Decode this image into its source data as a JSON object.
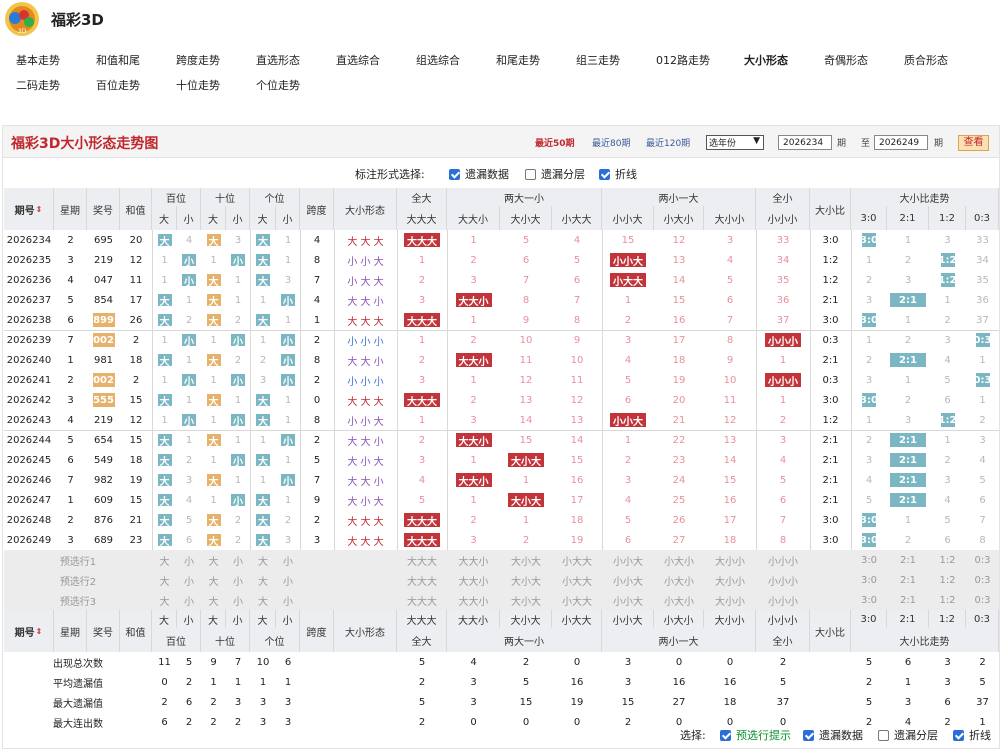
{
  "app": {
    "title": "福彩3D",
    "logo_icon": "lottery-ball-logo-icon"
  },
  "nav": [
    {
      "label": "基本走势",
      "active": false
    },
    {
      "label": "和值和尾",
      "active": false
    },
    {
      "label": "跨度走势",
      "active": false
    },
    {
      "label": "直选形态",
      "active": false
    },
    {
      "label": "直选综合",
      "active": false
    },
    {
      "label": "组选综合",
      "active": false
    },
    {
      "label": "和尾走势",
      "active": false
    },
    {
      "label": "组三走势",
      "active": false
    },
    {
      "label": "012路走势",
      "active": false
    },
    {
      "label": "大小形态",
      "active": true
    },
    {
      "label": "奇偶形态",
      "active": false
    },
    {
      "label": "质合形态",
      "active": false
    },
    {
      "label": "二码走势",
      "active": false
    },
    {
      "label": "百位走势",
      "active": false
    },
    {
      "label": "十位走势",
      "active": false
    },
    {
      "label": "个位走势",
      "active": false
    }
  ],
  "panel": {
    "title": "福彩3D大小形态走势图",
    "periods": [
      {
        "label": "最近50期",
        "active": true
      },
      {
        "label": "最近80期",
        "active": false
      },
      {
        "label": "最近120期",
        "active": false
      }
    ],
    "year_select": "选年份",
    "from_value": "2026234",
    "from_unit": "期",
    "to_label": "至",
    "to_value": "2026249",
    "to_unit": "期",
    "query": "查看"
  },
  "options_top": {
    "label": "标注形式选择:",
    "items": [
      {
        "label": "遗漏数据",
        "checked": true
      },
      {
        "label": "遗漏分层",
        "checked": false
      },
      {
        "label": "折线",
        "checked": true
      }
    ]
  },
  "options_bottom": {
    "label": "选择:",
    "items": [
      {
        "label": "预选行提示",
        "checked": true,
        "highlight": true
      },
      {
        "label": "遗漏数据",
        "checked": true
      },
      {
        "label": "遗漏分层",
        "checked": false
      },
      {
        "label": "折线",
        "checked": true
      }
    ]
  },
  "table": {
    "hdr": {
      "period": "期号",
      "weekday": "星期",
      "number": "奖号",
      "sum": "和值",
      "bai": "百位",
      "shi": "十位",
      "ge": "个位",
      "span": "跨度",
      "shape": "大小形态",
      "quanda": "全大",
      "ld1x": "两大一小",
      "lx1d": "两小一大",
      "quanxiao": "全小",
      "ratio": "大小比",
      "trend": "大小比走势",
      "da": "大",
      "xiao": "小",
      "sh": [
        "大大大",
        "大大小",
        "大小大",
        "小大大",
        "小小大",
        "小大小",
        "大小小",
        "小小小"
      ],
      "rt": [
        "3:0",
        "2:1",
        "1:2",
        "0:3"
      ]
    },
    "rows": [
      {
        "p": "2026234",
        "w": "2",
        "n": "695",
        "s": "20",
        "bai": [
          "大",
          "4"
        ],
        "shi": [
          "大",
          "3"
        ],
        "ge": [
          "大",
          "1"
        ],
        "sp": "4",
        "shape": "大 大 大",
        "sh": [
          "大大大",
          "1",
          "5",
          "4",
          "15",
          "12",
          "3",
          "33"
        ],
        "ratio": "3:0",
        "rt": [
          "3:0",
          "1",
          "3",
          "33"
        ]
      },
      {
        "p": "2026235",
        "w": "3",
        "n": "219",
        "s": "12",
        "bai": [
          "1",
          "小"
        ],
        "shi": [
          "1",
          "小"
        ],
        "ge": [
          "大",
          "1"
        ],
        "sp": "8",
        "shape": "小 小 大",
        "sh": [
          "1",
          "2",
          "6",
          "5",
          "小小大",
          "13",
          "4",
          "34"
        ],
        "ratio": "1:2",
        "rt": [
          "1",
          "2",
          "1:2",
          "34"
        ]
      },
      {
        "p": "2026236",
        "w": "4",
        "n": "047",
        "s": "11",
        "bai": [
          "1",
          "小"
        ],
        "shi": [
          "大",
          "1"
        ],
        "ge": [
          "大",
          "3"
        ],
        "sp": "7",
        "shape": "小 大 大",
        "sh": [
          "2",
          "3",
          "7",
          "6",
          "小大大",
          "14",
          "5",
          "35"
        ],
        "ratio": "1:2",
        "rt": [
          "2",
          "3",
          "1:2",
          "35"
        ]
      },
      {
        "p": "2026237",
        "w": "5",
        "n": "854",
        "s": "17",
        "bai": [
          "大",
          "1"
        ],
        "shi": [
          "大",
          "1"
        ],
        "ge": [
          "1",
          "小"
        ],
        "sp": "4",
        "shape": "大 大 小",
        "sh": [
          "3",
          "大大小",
          "8",
          "7",
          "1",
          "15",
          "6",
          "36"
        ],
        "ratio": "2:1",
        "rt": [
          "3",
          "2:1",
          "1",
          "36"
        ]
      },
      {
        "p": "2026238",
        "w": "6",
        "n": "899",
        "s": "26",
        "bai": [
          "大",
          "2"
        ],
        "shi": [
          "大",
          "2"
        ],
        "ge": [
          "大",
          "1"
        ],
        "sp": "1",
        "shape": "大 大 大",
        "sh": [
          "大大大",
          "1",
          "9",
          "8",
          "2",
          "16",
          "7",
          "37"
        ],
        "ratio": "3:0",
        "rt": [
          "3:0",
          "1",
          "2",
          "37"
        ]
      },
      {
        "p": "2026239",
        "w": "7",
        "n": "002",
        "s": "2",
        "bai": [
          "1",
          "小"
        ],
        "shi": [
          "1",
          "小"
        ],
        "ge": [
          "1",
          "小"
        ],
        "sp": "2",
        "shape": "小 小 小",
        "sh": [
          "1",
          "2",
          "10",
          "9",
          "3",
          "17",
          "8",
          "小小小"
        ],
        "ratio": "0:3",
        "rt": [
          "1",
          "2",
          "3",
          "0:3"
        ]
      },
      {
        "p": "2026240",
        "w": "1",
        "n": "981",
        "s": "18",
        "bai": [
          "大",
          "1"
        ],
        "shi": [
          "大",
          "2"
        ],
        "ge": [
          "2",
          "小"
        ],
        "sp": "8",
        "shape": "大 大 小",
        "sh": [
          "2",
          "大大小",
          "11",
          "10",
          "4",
          "18",
          "9",
          "1"
        ],
        "ratio": "2:1",
        "rt": [
          "2",
          "2:1",
          "4",
          "1"
        ]
      },
      {
        "p": "2026241",
        "w": "2",
        "n": "002",
        "s": "2",
        "bai": [
          "1",
          "小"
        ],
        "shi": [
          "1",
          "小"
        ],
        "ge": [
          "3",
          "小"
        ],
        "sp": "2",
        "shape": "小 小 小",
        "sh": [
          "3",
          "1",
          "12",
          "11",
          "5",
          "19",
          "10",
          "小小小"
        ],
        "ratio": "0:3",
        "rt": [
          "3",
          "1",
          "5",
          "0:3"
        ]
      },
      {
        "p": "2026242",
        "w": "3",
        "n": "555",
        "s": "15",
        "bai": [
          "大",
          "1"
        ],
        "shi": [
          "大",
          "1"
        ],
        "ge": [
          "大",
          "1"
        ],
        "sp": "0",
        "shape": "大 大 大",
        "sh": [
          "大大大",
          "2",
          "13",
          "12",
          "6",
          "20",
          "11",
          "1"
        ],
        "ratio": "3:0",
        "rt": [
          "3:0",
          "2",
          "6",
          "1"
        ]
      },
      {
        "p": "2026243",
        "w": "4",
        "n": "219",
        "s": "12",
        "bai": [
          "1",
          "小"
        ],
        "shi": [
          "1",
          "小"
        ],
        "ge": [
          "大",
          "1"
        ],
        "sp": "8",
        "shape": "小 小 大",
        "sh": [
          "1",
          "3",
          "14",
          "13",
          "小小大",
          "21",
          "12",
          "2"
        ],
        "ratio": "1:2",
        "rt": [
          "1",
          "3",
          "1:2",
          "2"
        ]
      },
      {
        "p": "2026244",
        "w": "5",
        "n": "654",
        "s": "15",
        "bai": [
          "大",
          "1"
        ],
        "shi": [
          "大",
          "1"
        ],
        "ge": [
          "1",
          "小"
        ],
        "sp": "2",
        "shape": "大 大 小",
        "sh": [
          "2",
          "大大小",
          "15",
          "14",
          "1",
          "22",
          "13",
          "3"
        ],
        "ratio": "2:1",
        "rt": [
          "2",
          "2:1",
          "1",
          "3"
        ]
      },
      {
        "p": "2026245",
        "w": "6",
        "n": "549",
        "s": "18",
        "bai": [
          "大",
          "2"
        ],
        "shi": [
          "1",
          "小"
        ],
        "ge": [
          "大",
          "1"
        ],
        "sp": "5",
        "shape": "大 小 大",
        "sh": [
          "3",
          "1",
          "大小大",
          "15",
          "2",
          "23",
          "14",
          "4"
        ],
        "ratio": "2:1",
        "rt": [
          "3",
          "2:1",
          "2",
          "4"
        ]
      },
      {
        "p": "2026246",
        "w": "7",
        "n": "982",
        "s": "19",
        "bai": [
          "大",
          "3"
        ],
        "shi": [
          "大",
          "1"
        ],
        "ge": [
          "1",
          "小"
        ],
        "sp": "7",
        "shape": "大 大 小",
        "sh": [
          "4",
          "大大小",
          "1",
          "16",
          "3",
          "24",
          "15",
          "5"
        ],
        "ratio": "2:1",
        "rt": [
          "4",
          "2:1",
          "3",
          "5"
        ]
      },
      {
        "p": "2026247",
        "w": "1",
        "n": "609",
        "s": "15",
        "bai": [
          "大",
          "4"
        ],
        "shi": [
          "1",
          "小"
        ],
        "ge": [
          "大",
          "1"
        ],
        "sp": "9",
        "shape": "大 小 大",
        "sh": [
          "5",
          "1",
          "大小大",
          "17",
          "4",
          "25",
          "16",
          "6"
        ],
        "ratio": "2:1",
        "rt": [
          "5",
          "2:1",
          "4",
          "6"
        ]
      },
      {
        "p": "2026248",
        "w": "2",
        "n": "876",
        "s": "21",
        "bai": [
          "大",
          "5"
        ],
        "shi": [
          "大",
          "2"
        ],
        "ge": [
          "大",
          "2"
        ],
        "sp": "2",
        "shape": "大 大 大",
        "sh": [
          "大大大",
          "2",
          "1",
          "18",
          "5",
          "26",
          "17",
          "7"
        ],
        "ratio": "3:0",
        "rt": [
          "3:0",
          "1",
          "5",
          "7"
        ]
      },
      {
        "p": "2026249",
        "w": "3",
        "n": "689",
        "s": "23",
        "bai": [
          "大",
          "6"
        ],
        "shi": [
          "大",
          "2"
        ],
        "ge": [
          "大",
          "3"
        ],
        "sp": "3",
        "shape": "大 大 大",
        "sh": [
          "大大大",
          "3",
          "2",
          "19",
          "6",
          "27",
          "18",
          "8"
        ],
        "ratio": "3:0",
        "rt": [
          "3:0",
          "2",
          "6",
          "8"
        ]
      }
    ],
    "preselect": [
      "预选行1",
      "预选行2",
      "预选行3"
    ],
    "stats": [
      {
        "label": "出现总次数",
        "v": [
          "11",
          "5",
          "9",
          "7",
          "10",
          "6",
          "5",
          "4",
          "2",
          "0",
          "3",
          "0",
          "0",
          "2",
          "5",
          "6",
          "3",
          "2"
        ]
      },
      {
        "label": "平均遗漏值",
        "v": [
          "0",
          "2",
          "1",
          "1",
          "1",
          "1",
          "2",
          "3",
          "5",
          "16",
          "3",
          "16",
          "16",
          "5",
          "2",
          "1",
          "3",
          "5"
        ]
      },
      {
        "label": "最大遗漏值",
        "v": [
          "2",
          "6",
          "2",
          "3",
          "3",
          "3",
          "5",
          "3",
          "15",
          "19",
          "15",
          "27",
          "18",
          "37",
          "5",
          "3",
          "6",
          "37"
        ]
      },
      {
        "label": "最大连出数",
        "v": [
          "6",
          "2",
          "2",
          "2",
          "3",
          "3",
          "2",
          "0",
          "0",
          "0",
          "2",
          "0",
          "0",
          "0",
          "2",
          "4",
          "2",
          "1"
        ]
      }
    ]
  }
}
